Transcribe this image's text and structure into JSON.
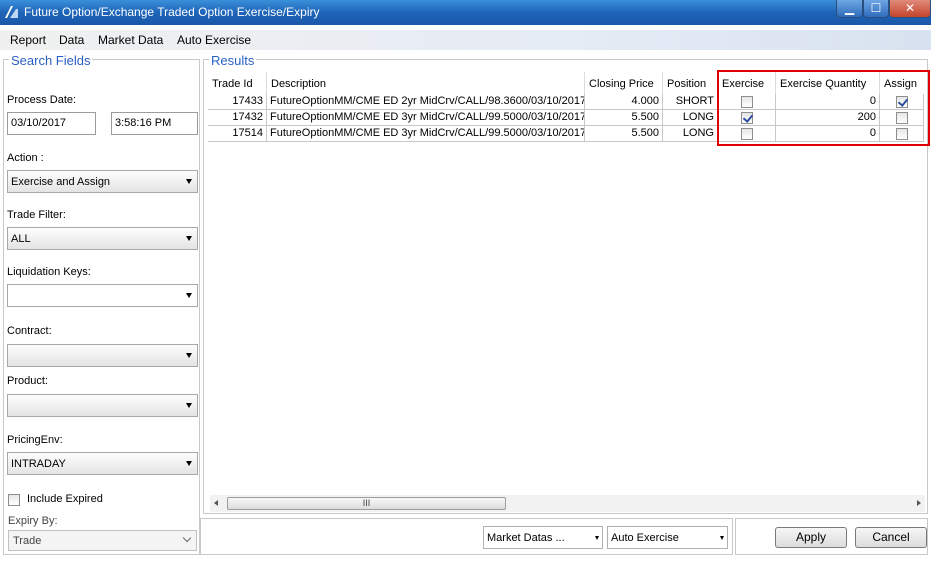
{
  "window": {
    "title": "Future Option/Exchange Traded Option Exercise/Expiry",
    "min_glyph": "▁",
    "max_glyph": "☐",
    "close_glyph": "✕"
  },
  "menu": [
    "Report",
    "Data",
    "Market Data",
    "Auto Exercise"
  ],
  "search": {
    "legend": "Search Fields",
    "process_date_label": "Process Date:",
    "process_date": "03/10/2017",
    "process_time": "3:58:16 PM",
    "action_label": "Action :",
    "action_value": "Exercise and Assign",
    "trade_filter_label": "Trade Filter:",
    "trade_filter_value": "ALL",
    "liquidation_keys_label": "Liquidation Keys:",
    "liquidation_keys_value": "",
    "contract_label": "Contract:",
    "contract_value": "",
    "product_label": "Product:",
    "product_value": "",
    "pricing_env_label": "PricingEnv:",
    "pricing_env_value": "INTRADAY",
    "include_expired_label": "Include Expired",
    "include_expired_checked": false,
    "expiry_by_label": "Expiry By:",
    "expiry_by_value": "Trade"
  },
  "results": {
    "legend": "Results",
    "columns": [
      "Trade Id",
      "Description",
      "Closing Price",
      "Position",
      "Exercise",
      "Exercise Quantity",
      "Assign"
    ],
    "rows": [
      {
        "trade_id": "17433",
        "description": "FutureOptionMM/CME ED 2yr MidCrv/CALL/98.3600/03/10/2017",
        "closing_price": "4.000",
        "position": "SHORT",
        "exercise": false,
        "exercise_quantity": "0",
        "assign": true
      },
      {
        "trade_id": "17432",
        "description": "FutureOptionMM/CME ED 3yr MidCrv/CALL/99.5000/03/10/2017",
        "closing_price": "5.500",
        "position": "LONG",
        "exercise": true,
        "exercise_quantity": "200",
        "assign": false
      },
      {
        "trade_id": "17514",
        "description": "FutureOptionMM/CME ED 3yr MidCrv/CALL/99.5000/03/10/2017",
        "closing_price": "5.500",
        "position": "LONG",
        "exercise": false,
        "exercise_quantity": "0",
        "assign": false
      }
    ],
    "scroll_thumb_label": "III"
  },
  "bottom": {
    "market_datas_value": "Market Datas ...",
    "auto_exercise_value": "Auto Exercise",
    "apply_label": "Apply",
    "cancel_label": "Cancel"
  },
  "colors": {
    "legend_blue": "#2a5fc4",
    "highlight_red": "#e00000",
    "titlebar_blue": "#1e64b8"
  }
}
